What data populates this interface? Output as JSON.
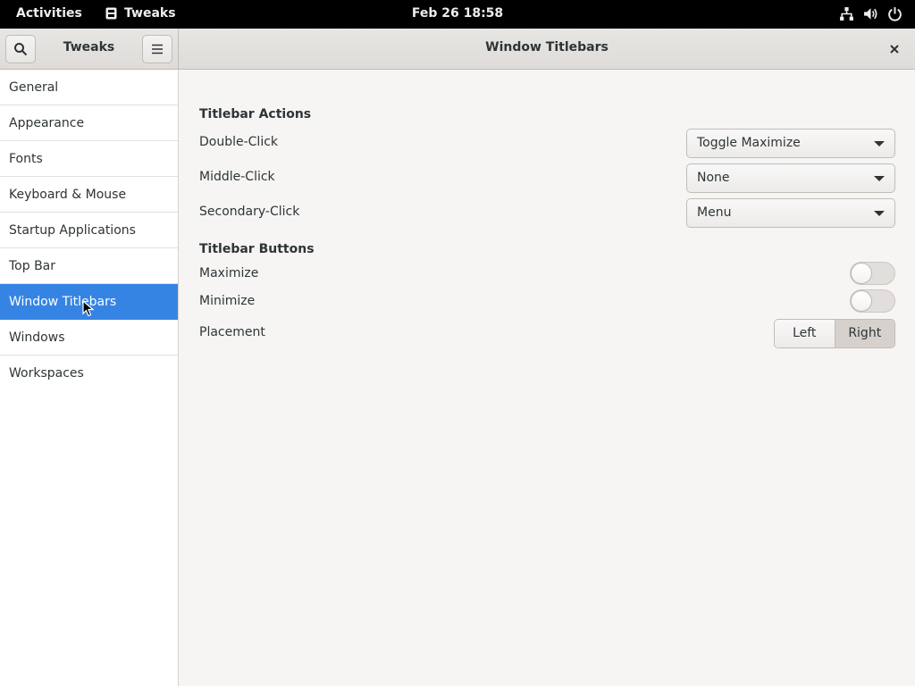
{
  "topbar": {
    "activities": "Activities",
    "app_name": "Tweaks",
    "clock": "Feb 26  18:58",
    "tray_icons": [
      "network-icon",
      "volume-icon",
      "power-icon"
    ]
  },
  "window": {
    "app_title": "Tweaks",
    "title": "Window Titlebars"
  },
  "sidebar": {
    "items": [
      {
        "label": "General"
      },
      {
        "label": "Appearance"
      },
      {
        "label": "Fonts"
      },
      {
        "label": "Keyboard & Mouse"
      },
      {
        "label": "Startup Applications"
      },
      {
        "label": "Top Bar"
      },
      {
        "label": "Window Titlebars",
        "selected": true
      },
      {
        "label": "Windows"
      },
      {
        "label": "Workspaces"
      }
    ]
  },
  "content": {
    "actions": {
      "title": "Titlebar Actions",
      "double_click": {
        "label": "Double-Click",
        "value": "Toggle Maximize"
      },
      "middle_click": {
        "label": "Middle-Click",
        "value": "None"
      },
      "secondary_click": {
        "label": "Secondary-Click",
        "value": "Menu"
      }
    },
    "buttons": {
      "title": "Titlebar Buttons",
      "maximize": {
        "label": "Maximize",
        "enabled": false
      },
      "minimize": {
        "label": "Minimize",
        "enabled": false
      },
      "placement": {
        "label": "Placement",
        "left": "Left",
        "right": "Right",
        "selected": "Right"
      }
    }
  },
  "colors": {
    "accent": "#3584e4",
    "background": "#f6f5f4",
    "sidebar": "#ffffff",
    "topbar": "#000000"
  }
}
